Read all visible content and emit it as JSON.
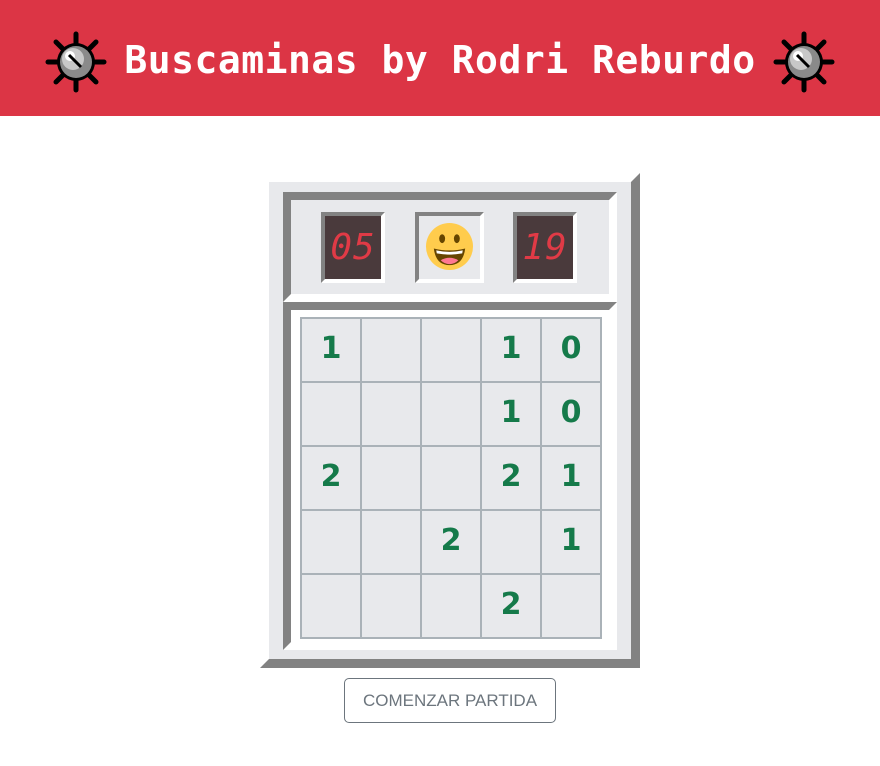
{
  "header": {
    "title": "Buscaminas by Rodri Reburdo",
    "background_color": "#dc3545",
    "left_icon": "mine-icon",
    "right_icon": "mine-icon"
  },
  "game": {
    "mine_counter": "05",
    "timer": "19",
    "face_icon": "smiley-face-icon",
    "board": [
      [
        "1",
        "",
        "",
        "1",
        "0"
      ],
      [
        "",
        "",
        "",
        "1",
        "0"
      ],
      [
        "2",
        "",
        "",
        "2",
        "1"
      ],
      [
        "",
        "",
        "2",
        "",
        "1"
      ],
      [
        "",
        "",
        "",
        "2",
        ""
      ]
    ],
    "number_color": "#157a4a",
    "counter_digit_color": "#e03a46"
  },
  "start_button": {
    "label": "COMENZAR PARTIDA"
  }
}
